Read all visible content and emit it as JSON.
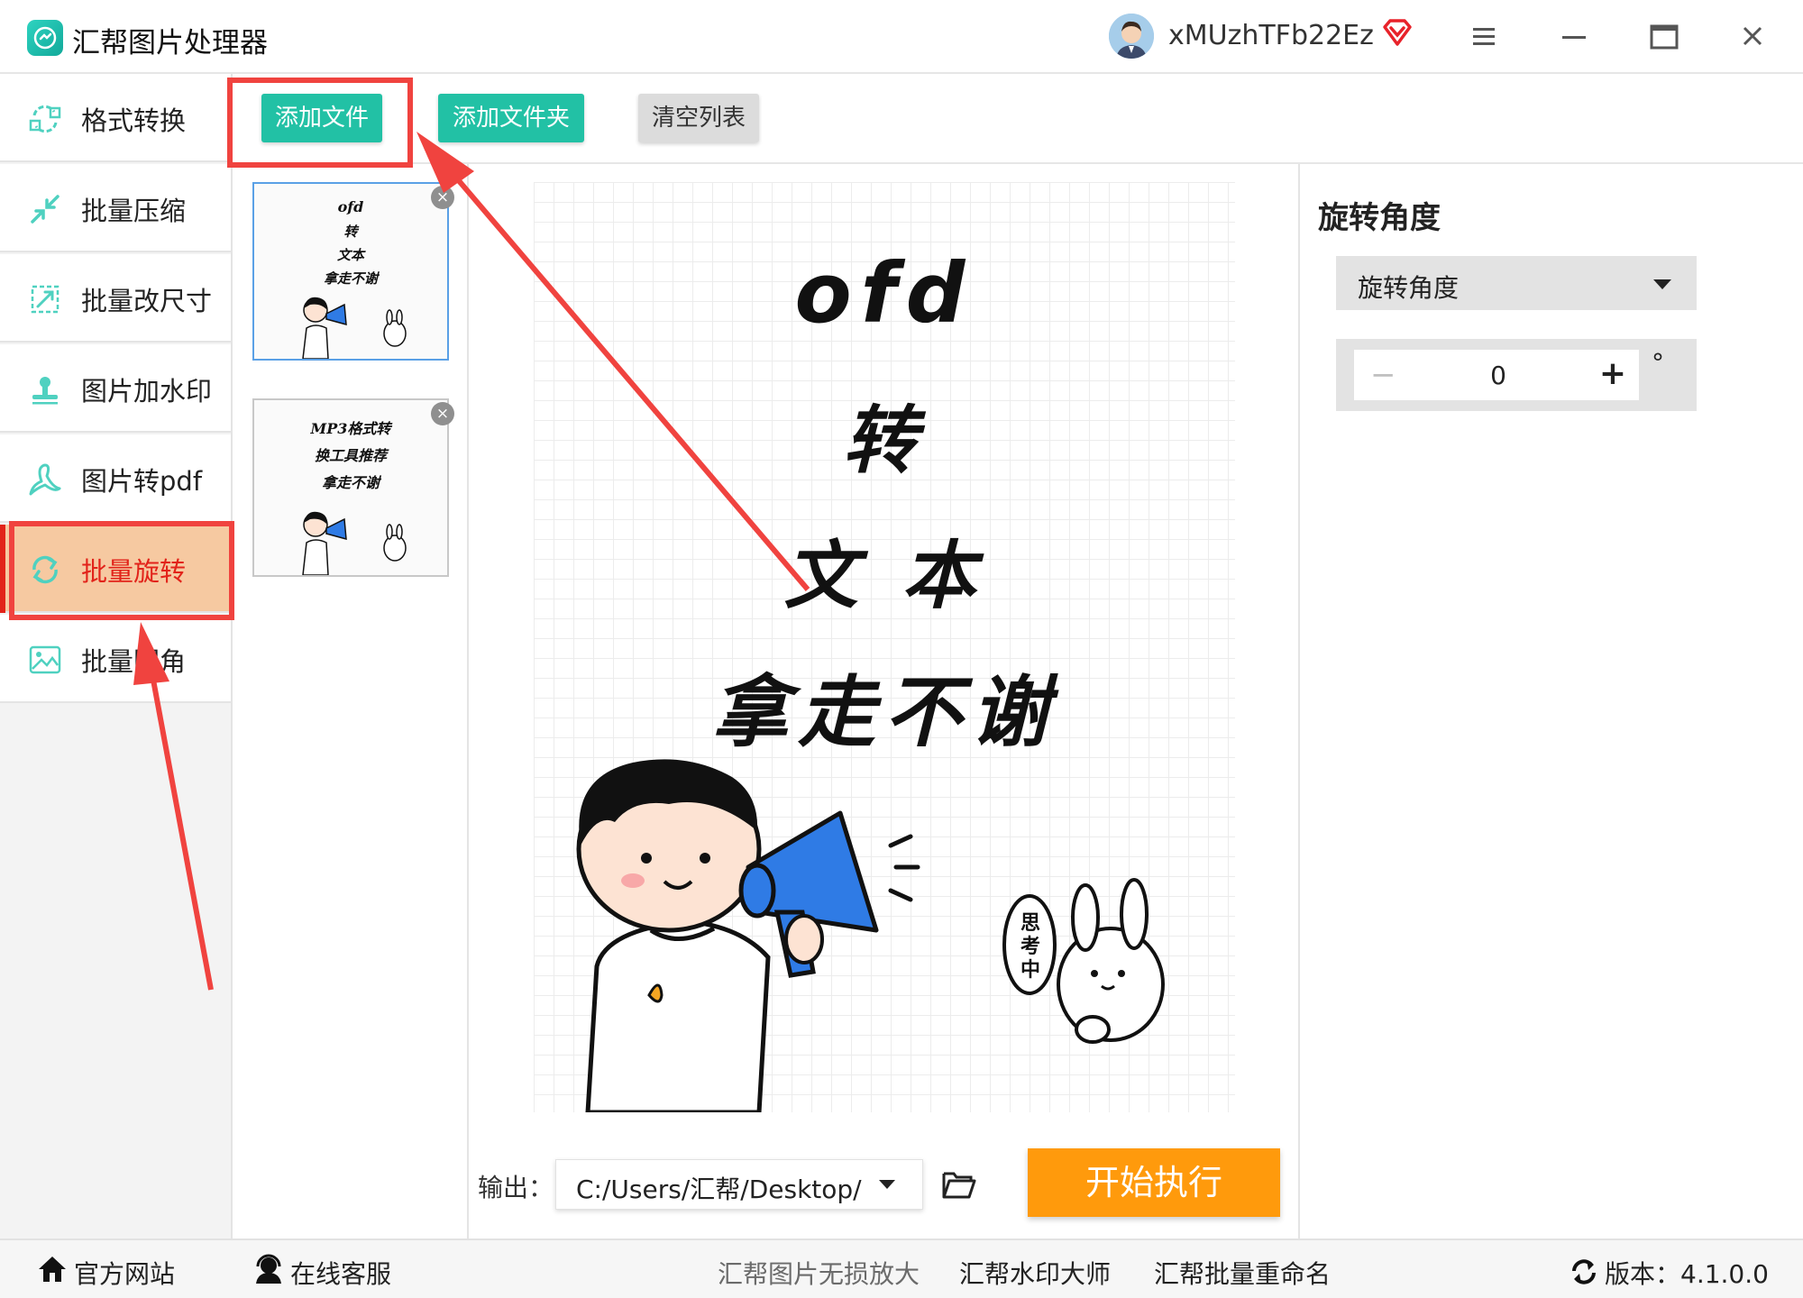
{
  "app": {
    "title": "汇帮图片处理器"
  },
  "user": {
    "name": "xMUzhTFb22Ez"
  },
  "sidebar": {
    "items": [
      {
        "label": "格式转换",
        "icon": "format-convert-icon"
      },
      {
        "label": "批量压缩",
        "icon": "compress-icon"
      },
      {
        "label": "批量改尺寸",
        "icon": "resize-icon"
      },
      {
        "label": "图片加水印",
        "icon": "watermark-icon"
      },
      {
        "label": "图片转pdf",
        "icon": "pdf-icon"
      },
      {
        "label": "批量旋转",
        "icon": "rotate-icon",
        "active": true
      },
      {
        "label": "批量圆角",
        "icon": "image-icon"
      }
    ]
  },
  "toolbar": {
    "add_file": "添加文件",
    "add_folder": "添加文件夹",
    "clear_list": "清空列表"
  },
  "thumbnails": [
    {
      "lines": [
        "ofd",
        "转",
        "文本",
        "拿走不谢"
      ],
      "selected": true
    },
    {
      "lines": [
        "MP3格式转",
        "换工具推荐",
        "拿走不谢"
      ],
      "selected": false
    }
  ],
  "preview": {
    "lines": [
      "ofd",
      "转",
      "文 本",
      "拿走不谢"
    ],
    "bubble": "思考中"
  },
  "rotate_panel": {
    "title": "旋转角度",
    "select_value": "旋转角度",
    "angle_value": "0",
    "unit": "°",
    "minus": "−",
    "plus": "+"
  },
  "output": {
    "label": "输出：",
    "path": "C:/Users/汇帮/Desktop/",
    "start_button": "开始执行"
  },
  "footer": {
    "website": "官方网站",
    "support": "在线客服",
    "link1": "汇帮图片无损放大",
    "link2": "汇帮水印大师",
    "link3": "汇帮批量重命名",
    "version": "版本：4.1.0.0"
  },
  "colors": {
    "accent_teal": "#22c1a5",
    "start_orange": "#ff9a0c",
    "active_bg": "#f6c9a1",
    "active_text": "#e2231a",
    "annotation_red": "#f0433f"
  }
}
